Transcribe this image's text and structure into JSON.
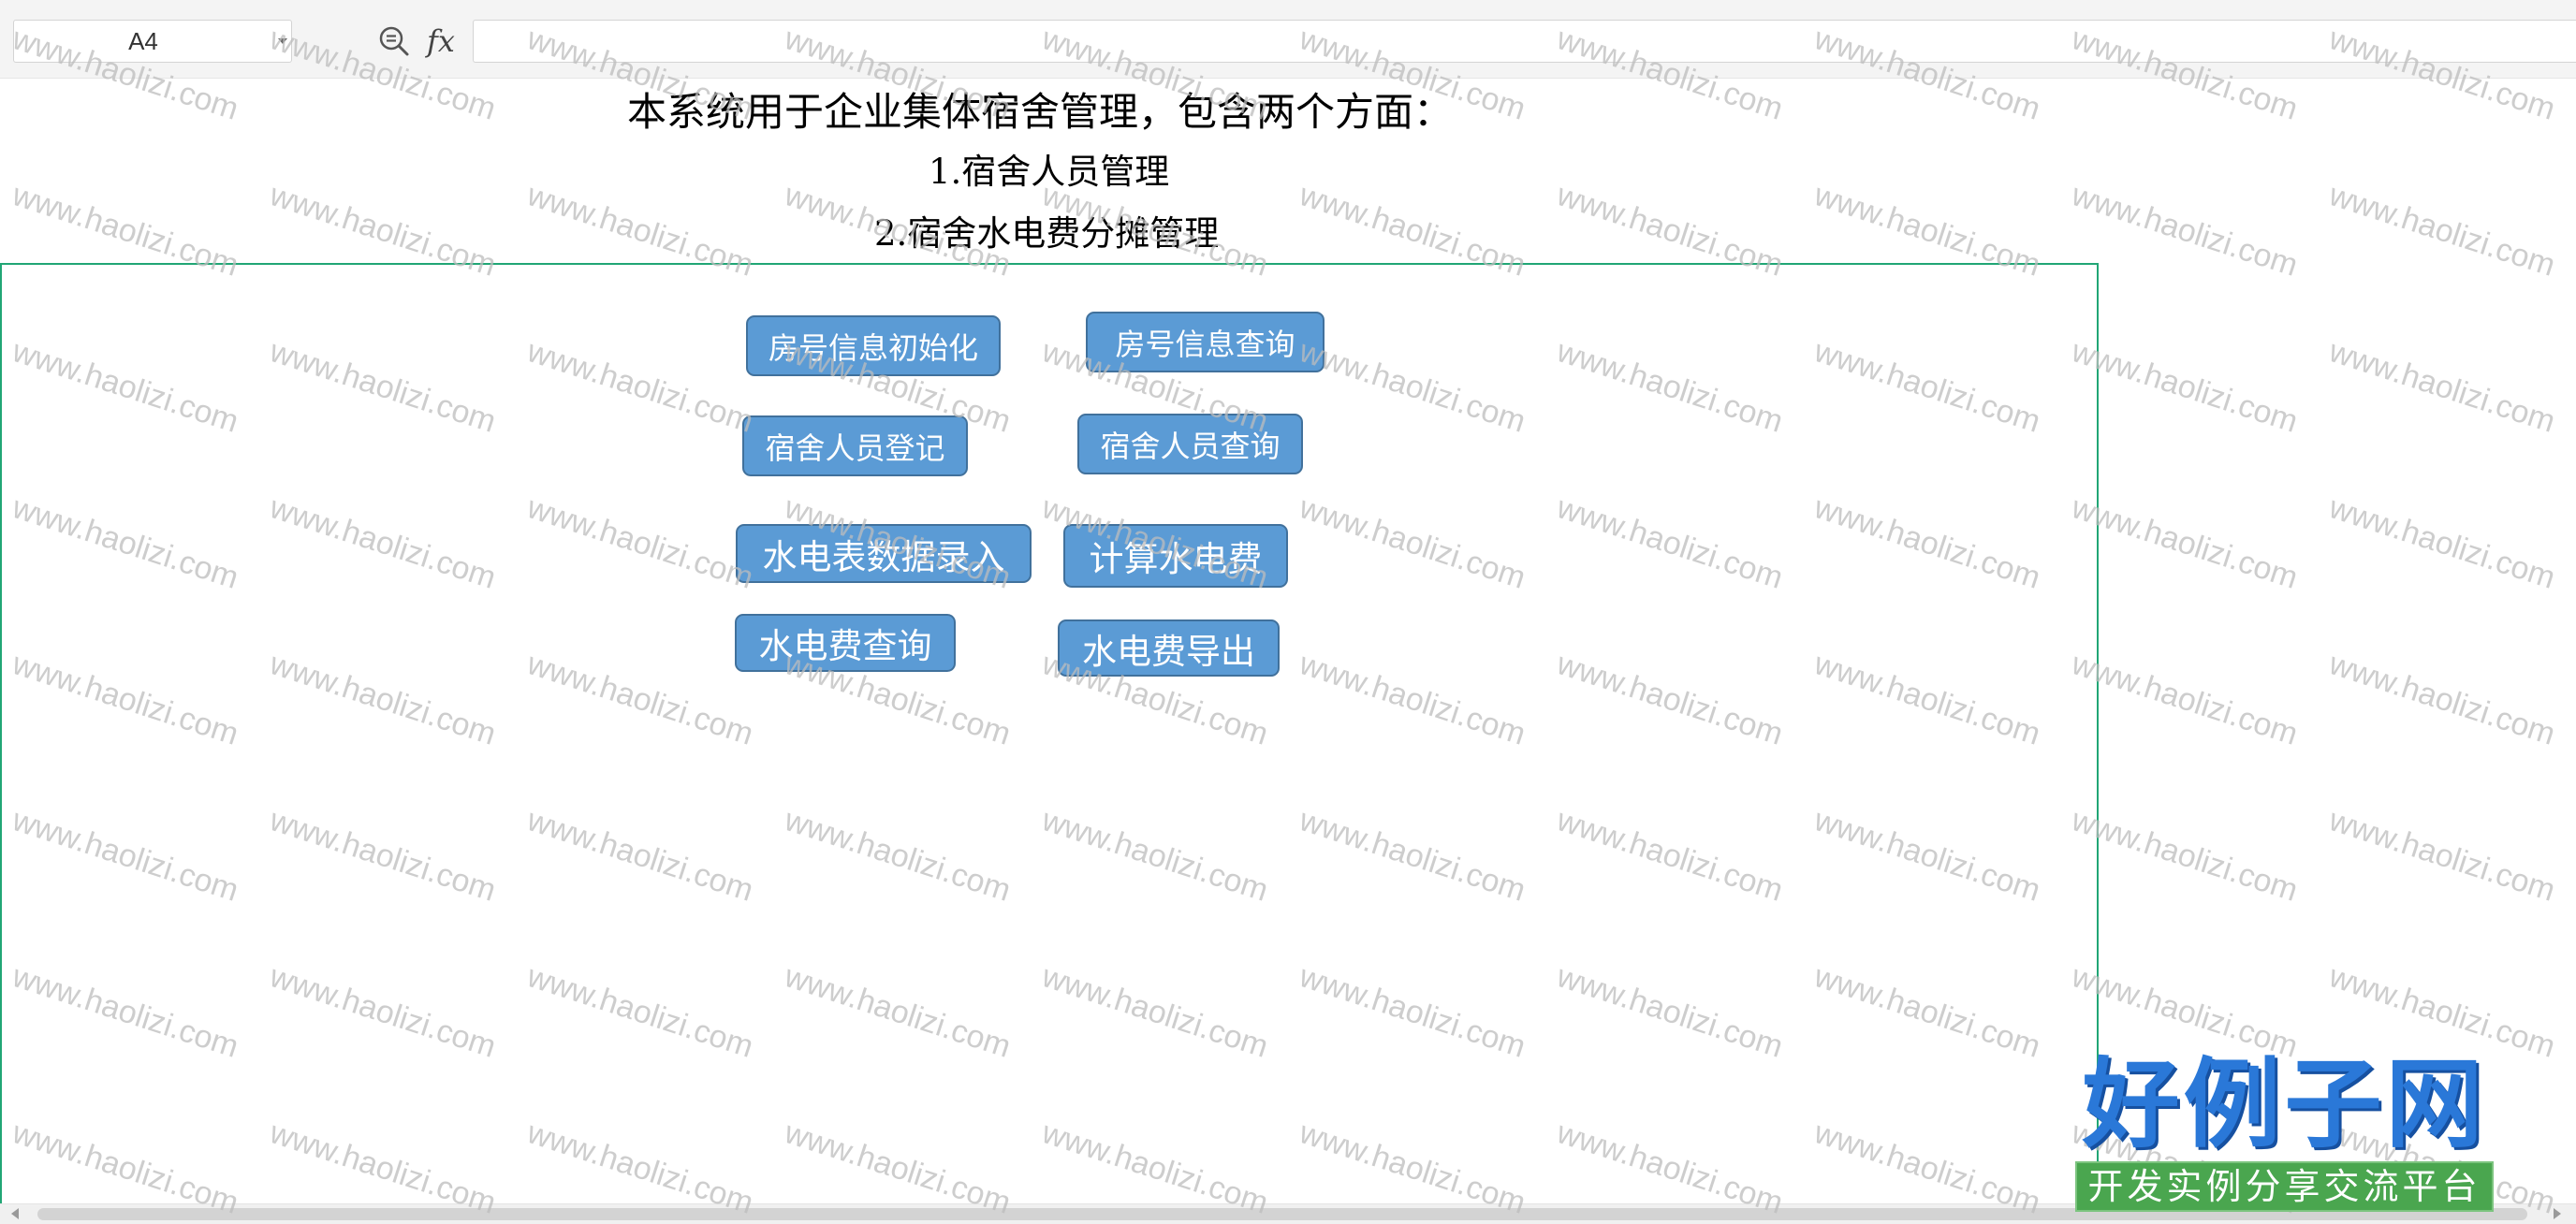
{
  "formula_bar": {
    "name_box_value": "A4",
    "name_box_icon": "chevron-down-icon",
    "preview_icon": "magnifier-icon",
    "function_label": "fx",
    "formula_value": ""
  },
  "sheet": {
    "intro": {
      "heading": "本系统用于企业集体宿舍管理，包含两个方面：",
      "items": [
        "1.宿舍人员管理",
        "2.宿舍水电费分摊管理"
      ]
    },
    "buttons": [
      {
        "label": "房号信息初始化"
      },
      {
        "label": "房号信息查询"
      },
      {
        "label": "宿舍人员登记"
      },
      {
        "label": "宿舍人员查询"
      },
      {
        "label": "水电表数据录入"
      },
      {
        "label": "计算水电费"
      },
      {
        "label": "水电费查询"
      },
      {
        "label": "水电费导出"
      }
    ]
  },
  "scrollbar": {
    "left_icon": "chevron-left-icon",
    "right_icon": "chevron-right-icon"
  },
  "watermark": {
    "text": "www.haolizi.com"
  },
  "logo": {
    "title": "好例子网",
    "tagline": "开发实例分享交流平台"
  },
  "colors": {
    "toolbar_bg": "#f4f4f4",
    "sheet_bg": "#ffffff",
    "selection_border": "#21a675",
    "button_fill": "#5b9bd5",
    "button_border": "#41719c",
    "button_text": "#ffffff",
    "heading_text": "#000000",
    "watermark_text": "#bdbdbd",
    "logo_blue": "#2a78d8",
    "logo_banner": "#4aa64f"
  }
}
